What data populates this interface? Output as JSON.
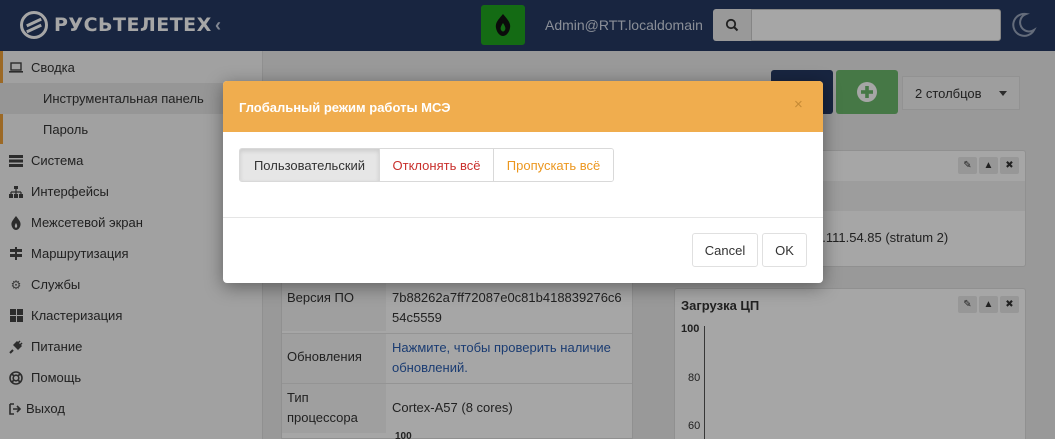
{
  "header": {
    "brand": "РУСЬТЕЛЕТЕХ",
    "collapse_icon": "chevron-left-icon",
    "user": "Admin@RTT.localdomain",
    "search_placeholder": "",
    "theme_icon": "moon-icon"
  },
  "sidebar": {
    "items": [
      {
        "label": "Сводка",
        "icon": "laptop-icon"
      },
      {
        "label": "Инструментальная панель",
        "sub": true
      },
      {
        "label": "Пароль",
        "sub": true
      },
      {
        "label": "Система",
        "icon": "server-icon"
      },
      {
        "label": "Интерфейсы",
        "icon": "sitemap-icon"
      },
      {
        "label": "Межсетевой экран",
        "icon": "fire-icon"
      },
      {
        "label": "Маршрутизация",
        "icon": "signpost-icon"
      },
      {
        "label": "Службы",
        "icon": "gear-icon"
      },
      {
        "label": "Кластеризация",
        "icon": "grid-icon"
      },
      {
        "label": "Питание",
        "icon": "plug-icon"
      },
      {
        "label": "Помощь",
        "icon": "lifebuoy-icon"
      },
      {
        "label": "Выход",
        "icon": "sign-out-icon"
      }
    ]
  },
  "main": {
    "columns_select": "2 столбцов",
    "ntp_widget": {
      "value": "3.111.54.85 (stratum 2)"
    },
    "cpu_widget": {
      "title": "Загрузка ЦП",
      "ticks": [
        "100",
        "80",
        "60"
      ]
    },
    "sysinfo": {
      "rows": [
        {
          "key": "Версия ПО",
          "value": "7b88262a7ff72087e0c81b418839276c654c5559"
        },
        {
          "key": "Обновления",
          "value": "Нажмите, чтобы проверить наличие обновлений."
        },
        {
          "key": "Тип процессора",
          "value": "Cortex-A57 (8 cores)"
        }
      ],
      "partial": "100"
    }
  },
  "modal": {
    "title": "Глобальный режим работы МСЭ",
    "close": "×",
    "options": [
      "Пользовательский",
      "Отклонять всё",
      "Пропускать всё"
    ],
    "selected": "Пользовательский",
    "cancel": "Cancel",
    "ok": "OK"
  },
  "colors": {
    "header_bg": "#253a63",
    "modal_head": "#f0ad4e",
    "accent": "#f0a23a"
  }
}
